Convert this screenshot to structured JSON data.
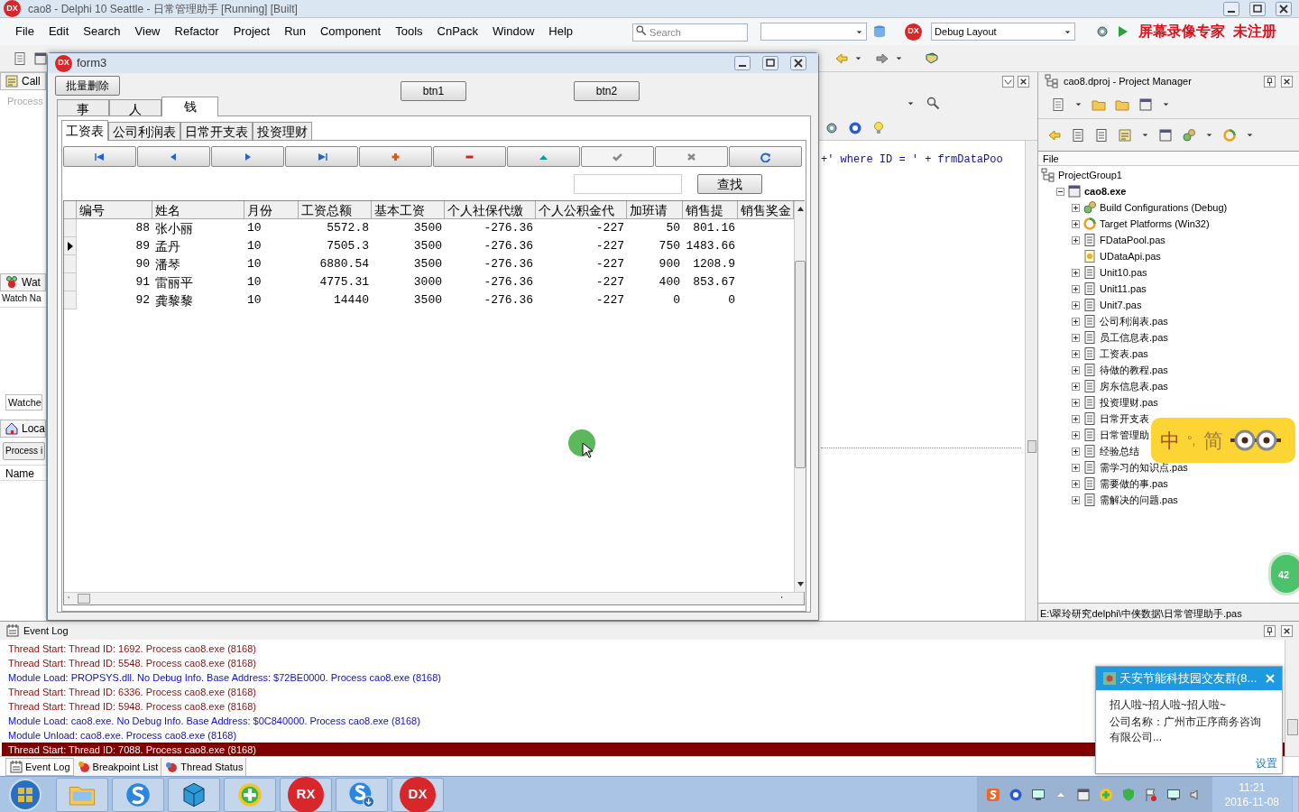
{
  "ide": {
    "logo": "DX",
    "title": "cao8 - Delphi 10 Seattle - 日常管理助手 [Running] [Built]",
    "menu": [
      "File",
      "Edit",
      "Search",
      "View",
      "Refactor",
      "Project",
      "Run",
      "Component",
      "Tools",
      "CnPack",
      "Window",
      "Help"
    ],
    "search": {
      "placeholder": "Search"
    },
    "menu_logo": "DX",
    "layout_combo": "Debug Layout",
    "recorder_notice": "屏幕录像专家  未注册"
  },
  "left_dock": {
    "call_stack": {
      "tab": "Call",
      "hint": "Process"
    },
    "watches": {
      "tab": "Wat",
      "header": "Watch Na",
      "bottom_tab": "Watche"
    },
    "locals": {
      "tab": "Loca",
      "combo": "Process i",
      "header": "Name"
    }
  },
  "editor": {
    "code": "+' where ID = ' + frmDataPoo"
  },
  "form3": {
    "logo": "DX",
    "title": "form3",
    "buttons": [
      "批量删除",
      "btn1",
      "btn2"
    ],
    "tabs": [
      {
        "label": "事",
        "selected": false
      },
      {
        "label": "人",
        "selected": false
      },
      {
        "label": "钱",
        "selected": true
      }
    ],
    "sheets": [
      {
        "label": "工资表",
        "selected": true
      },
      {
        "label": "公司利润表",
        "selected": false
      },
      {
        "label": "日常开支表",
        "selected": false
      },
      {
        "label": "投资理财",
        "selected": false
      }
    ],
    "navigator": [
      {
        "kind": "first",
        "disabled": false
      },
      {
        "kind": "prior",
        "disabled": false
      },
      {
        "kind": "next",
        "disabled": false
      },
      {
        "kind": "last",
        "disabled": false
      },
      {
        "kind": "insert",
        "disabled": false
      },
      {
        "kind": "delete",
        "disabled": false
      },
      {
        "kind": "edit",
        "disabled": false
      },
      {
        "kind": "post",
        "disabled": true
      },
      {
        "kind": "cancel",
        "disabled": true
      },
      {
        "kind": "refresh",
        "disabled": false
      }
    ],
    "find_button": "查找",
    "grid": {
      "columns": [
        "编号",
        "姓名",
        "月份",
        "工资总额",
        "基本工资",
        "个人社保代缴",
        "个人公积金代",
        "加班请",
        "销售提",
        "销售奖金"
      ],
      "rows": [
        {
          "current": false,
          "cells": [
            "88",
            "张小丽",
            "10",
            "5572.8",
            "3500",
            "-276.36",
            "-227",
            "50",
            "801.16",
            ""
          ]
        },
        {
          "current": true,
          "cells": [
            "89",
            "孟丹",
            "10",
            "7505.3",
            "3500",
            "-276.36",
            "-227",
            "750",
            "1483.66",
            ""
          ]
        },
        {
          "current": false,
          "cells": [
            "90",
            "潘琴",
            "10",
            "6880.54",
            "3500",
            "-276.36",
            "-227",
            "900",
            "1208.9",
            ""
          ]
        },
        {
          "current": false,
          "cells": [
            "91",
            "雷丽平",
            "10",
            "4775.31",
            "3000",
            "-276.36",
            "-227",
            "400",
            "853.67",
            ""
          ]
        },
        {
          "current": false,
          "cells": [
            "92",
            "龚黎黎",
            "10",
            "14440",
            "3500",
            "-276.36",
            "-227",
            "0",
            "0",
            ""
          ]
        }
      ]
    }
  },
  "project_manager": {
    "title": "cao8.dproj - Project Manager",
    "header": "File",
    "tree": [
      {
        "label": "ProjectGroup1",
        "kind": "group",
        "children": [
          {
            "label": "cao8.exe",
            "kind": "exe",
            "expanded": true,
            "children": [
              {
                "label": "Build Configurations (Debug)",
                "kind": "config",
                "expanded": false
              },
              {
                "label": "Target Platforms (Win32)",
                "kind": "platform",
                "expanded": false
              },
              {
                "label": "FDataPool.pas",
                "kind": "unit",
                "expanded": false
              },
              {
                "label": "UDataApi.pas",
                "kind": "datamodule"
              },
              {
                "label": "Unit10.pas",
                "kind": "unit",
                "expanded": false
              },
              {
                "label": "Unit11.pas",
                "kind": "unit",
                "expanded": false
              },
              {
                "label": "Unit7.pas",
                "kind": "unit",
                "expanded": false
              },
              {
                "label": "公司利润表.pas",
                "kind": "unit",
                "expanded": false
              },
              {
                "label": "员工信息表.pas",
                "kind": "unit",
                "expanded": false
              },
              {
                "label": "工资表.pas",
                "kind": "unit",
                "expanded": false
              },
              {
                "label": "待做的教程.pas",
                "kind": "unit",
                "expanded": false
              },
              {
                "label": "房东信息表.pas",
                "kind": "unit",
                "expanded": false
              },
              {
                "label": "投资理财.pas",
                "kind": "unit",
                "expanded": false
              },
              {
                "label": "日常开支表",
                "kind": "unit",
                "expanded": false
              },
              {
                "label": "日常管理助",
                "kind": "unit",
                "expanded": false
              },
              {
                "label": "经验总结",
                "kind": "unit",
                "expanded": false
              },
              {
                "label": "需学习的知识点.pas",
                "kind": "unit",
                "expanded": false
              },
              {
                "label": "需要做的事.pas",
                "kind": "unit",
                "expanded": false
              },
              {
                "label": "需解决的问题.pas",
                "kind": "unit",
                "expanded": false
              }
            ]
          }
        ]
      }
    ],
    "path": "E:\\翠玲研究delphi\\中侠数据\\日常管理助手.pas"
  },
  "event_log": {
    "title": "Event Log",
    "lines": [
      {
        "kind": "thread",
        "selected": false,
        "text": "Thread Start: Thread ID: 1692. Process cao8.exe (8168)"
      },
      {
        "kind": "thread",
        "selected": false,
        "text": "Thread Start: Thread ID: 5548. Process cao8.exe (8168)"
      },
      {
        "kind": "module",
        "selected": false,
        "text": "Module Load: PROPSYS.dll. No Debug Info. Base Address: $72BE0000. Process cao8.exe (8168)"
      },
      {
        "kind": "thread",
        "selected": false,
        "text": "Thread Start: Thread ID: 6336. Process cao8.exe (8168)"
      },
      {
        "kind": "thread",
        "selected": false,
        "text": "Thread Start: Thread ID: 5948. Process cao8.exe (8168)"
      },
      {
        "kind": "module",
        "selected": false,
        "text": "Module Load: cao8.exe. No Debug Info. Base Address: $0C840000. Process cao8.exe (8168)"
      },
      {
        "kind": "module",
        "selected": false,
        "text": "Module Unload: cao8.exe. Process cao8.exe (8168)"
      },
      {
        "kind": "thread",
        "selected": true,
        "text": "Thread Start: Thread ID: 7088. Process cao8.exe (8168)"
      }
    ],
    "tabs": [
      {
        "label": "Event Log",
        "selected": true
      },
      {
        "label": "Breakpoint List",
        "selected": false
      },
      {
        "label": "Thread Status",
        "selected": false
      }
    ]
  },
  "taskbar": {
    "apps": [
      {
        "kind": "folder"
      },
      {
        "kind": "sogou"
      },
      {
        "kind": "cube"
      },
      {
        "kind": "plus"
      },
      {
        "kind": "logo",
        "label": "RX"
      },
      {
        "kind": "sogou-download"
      },
      {
        "kind": "logo",
        "label": "DX"
      }
    ],
    "clock": {
      "time": "11:21",
      "date": "2016-11-08"
    }
  },
  "chat_popup": {
    "title": "天安节能科技园交友群(8...",
    "message": [
      "招人啦~招人啦~招人啦~",
      "公司名称：广州市正序商务咨询有限公司..."
    ],
    "settings_link": "设置"
  },
  "ime_bar": {
    "mode": "中",
    "punct": "°,",
    "script": "简"
  },
  "side_badge": "42"
}
